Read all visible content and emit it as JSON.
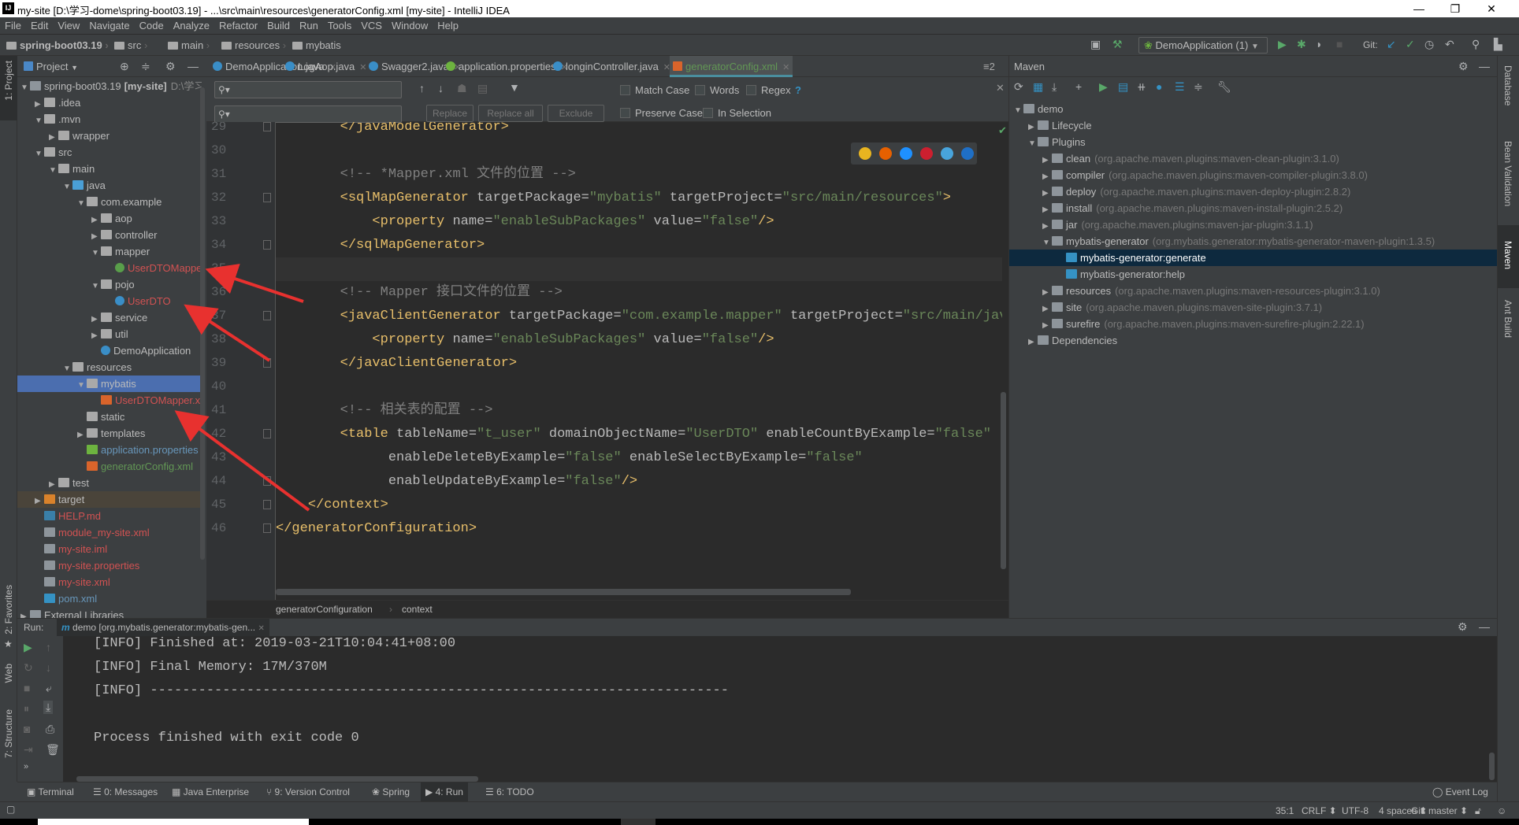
{
  "window": {
    "title": "my-site [D:\\学习-dome\\spring-boot03.19] - ...\\src\\main\\resources\\generatorConfig.xml [my-site] - IntelliJ IDEA",
    "app_icon": "IJ"
  },
  "menu": [
    "File",
    "Edit",
    "View",
    "Navigate",
    "Code",
    "Analyze",
    "Refactor",
    "Build",
    "Run",
    "Tools",
    "VCS",
    "Window",
    "Help"
  ],
  "breadcrumb": [
    "spring-boot03.19",
    "src",
    "main",
    "resources",
    "mybatis"
  ],
  "toolbar": {
    "run_config": "DemoApplication (1)",
    "git_label": "Git:"
  },
  "left_strip": {
    "project": "1: Project",
    "favorites": "2: Favorites",
    "web": "Web",
    "structure": "7: Structure"
  },
  "right_strip": {
    "database": "Database",
    "bean_validation": "Bean Validation",
    "maven": "Maven",
    "ant_build": "Ant Build"
  },
  "project_panel": {
    "title": "Project",
    "items": [
      {
        "depth": 0,
        "state": "open",
        "icon": "module",
        "label": "spring-boot03.19",
        "extra": "[my-site]",
        "path": "D:\\学习",
        "color": "#bbbbbb"
      },
      {
        "depth": 1,
        "state": "closed",
        "icon": "folder",
        "label": ".idea",
        "color": "#bbbbbb"
      },
      {
        "depth": 1,
        "state": "open",
        "icon": "folder",
        "label": ".mvn",
        "color": "#bbbbbb"
      },
      {
        "depth": 2,
        "state": "closed",
        "icon": "folder",
        "label": "wrapper",
        "color": "#bbbbbb"
      },
      {
        "depth": 1,
        "state": "open",
        "icon": "folder",
        "label": "src",
        "color": "#bbbbbb"
      },
      {
        "depth": 2,
        "state": "open",
        "icon": "folder",
        "label": "main",
        "color": "#bbbbbb"
      },
      {
        "depth": 3,
        "state": "open",
        "icon": "source-folder",
        "label": "java",
        "color": "#bbbbbb"
      },
      {
        "depth": 4,
        "state": "open",
        "icon": "package",
        "label": "com.example",
        "color": "#bbbbbb"
      },
      {
        "depth": 5,
        "state": "closed",
        "icon": "package",
        "label": "aop",
        "color": "#bbbbbb"
      },
      {
        "depth": 5,
        "state": "closed",
        "icon": "package",
        "label": "controller",
        "color": "#bbbbbb"
      },
      {
        "depth": 5,
        "state": "open",
        "icon": "package",
        "label": "mapper",
        "color": "#bbbbbb"
      },
      {
        "depth": 6,
        "state": "none",
        "icon": "interface",
        "label": "UserDTOMapper",
        "color": "#d25252"
      },
      {
        "depth": 5,
        "state": "open",
        "icon": "package",
        "label": "pojo",
        "color": "#bbbbbb"
      },
      {
        "depth": 6,
        "state": "none",
        "icon": "class",
        "label": "UserDTO",
        "color": "#d25252"
      },
      {
        "depth": 5,
        "state": "closed",
        "icon": "package",
        "label": "service",
        "color": "#bbbbbb"
      },
      {
        "depth": 5,
        "state": "closed",
        "icon": "package",
        "label": "util",
        "color": "#bbbbbb"
      },
      {
        "depth": 5,
        "state": "none",
        "icon": "spring-class",
        "label": "DemoApplication",
        "color": "#bbbbbb"
      },
      {
        "depth": 3,
        "state": "open",
        "icon": "resources-folder",
        "label": "resources",
        "color": "#bbbbbb"
      },
      {
        "depth": 4,
        "state": "open",
        "icon": "package",
        "label": "mybatis",
        "color": "#bbbbbb",
        "selected": true
      },
      {
        "depth": 5,
        "state": "none",
        "icon": "xml",
        "label": "UserDTOMapper.xml",
        "color": "#d25252"
      },
      {
        "depth": 4,
        "state": "none",
        "icon": "package",
        "label": "static",
        "color": "#bbbbbb"
      },
      {
        "depth": 4,
        "state": "closed",
        "icon": "package",
        "label": "templates",
        "color": "#bbbbbb"
      },
      {
        "depth": 4,
        "state": "none",
        "icon": "spring-properties",
        "label": "application.properties",
        "color": "#6897bb"
      },
      {
        "depth": 4,
        "state": "none",
        "icon": "xml",
        "label": "generatorConfig.xml",
        "color": "#629755"
      },
      {
        "depth": 2,
        "state": "closed",
        "icon": "folder",
        "label": "test",
        "color": "#bbbbbb"
      },
      {
        "depth": 1,
        "state": "closed",
        "icon": "excluded-folder",
        "label": "target",
        "color": "#bbbbbb",
        "excluded": true
      },
      {
        "depth": 1,
        "state": "none",
        "icon": "markdown",
        "label": "HELP.md",
        "color": "#d25252"
      },
      {
        "depth": 1,
        "state": "none",
        "icon": "xml-file",
        "label": "module_my-site.xml",
        "color": "#d25252"
      },
      {
        "depth": 1,
        "state": "none",
        "icon": "iml-file",
        "label": "my-site.iml",
        "color": "#d25252"
      },
      {
        "depth": 1,
        "state": "none",
        "icon": "properties-file",
        "label": "my-site.properties",
        "color": "#d25252"
      },
      {
        "depth": 1,
        "state": "none",
        "icon": "xml-file",
        "label": "my-site.xml",
        "color": "#d25252"
      },
      {
        "depth": 1,
        "state": "none",
        "icon": "maven",
        "label": "pom.xml",
        "color": "#6897bb"
      },
      {
        "depth": 0,
        "state": "closed",
        "icon": "libraries",
        "label": "External Libraries",
        "color": "#bbbbbb"
      }
    ]
  },
  "editor_tabs": [
    {
      "label": "DemoApplication.java",
      "icon": "spring-class",
      "active": false
    },
    {
      "label": "LogAop.java",
      "icon": "class",
      "active": false
    },
    {
      "label": "Swagger2.java",
      "icon": "class",
      "active": false
    },
    {
      "label": "application.properties",
      "icon": "spring-properties",
      "active": false
    },
    {
      "label": "longinController.java",
      "icon": "class",
      "active": false
    },
    {
      "label": "generatorConfig.xml",
      "icon": "xml",
      "active": true
    }
  ],
  "tabs_overflow": "≡2",
  "find_bar": {
    "search_value": "",
    "replace_value": "",
    "match_case": "Match Case",
    "words": "Words",
    "regex": "Regex",
    "help": "?",
    "preserve_case": "Preserve Case",
    "in_selection": "In Selection",
    "replace": "Replace",
    "replace_all": "Replace all",
    "exclude": "Exclude"
  },
  "code": {
    "current_line": 35,
    "lines": [
      {
        "n": 29,
        "tokens": [
          [
            "txt",
            "        "
          ],
          [
            "tag",
            "</javaModelGenerator>"
          ]
        ]
      },
      {
        "n": 30,
        "tokens": []
      },
      {
        "n": 31,
        "tokens": [
          [
            "txt",
            "        "
          ],
          [
            "cmt",
            "<!-- *Mapper.xml 文件的位置 -->"
          ]
        ]
      },
      {
        "n": 32,
        "tokens": [
          [
            "txt",
            "        "
          ],
          [
            "tag",
            "<sqlMapGenerator"
          ],
          [
            "attr",
            " targetPackage="
          ],
          [
            "val",
            "\"mybatis\""
          ],
          [
            "attr",
            " targetProject="
          ],
          [
            "val",
            "\"src/main/resources\""
          ],
          [
            "tag",
            ">"
          ]
        ]
      },
      {
        "n": 33,
        "tokens": [
          [
            "txt",
            "            "
          ],
          [
            "tag",
            "<property"
          ],
          [
            "attr",
            " name="
          ],
          [
            "val",
            "\"enableSubPackages\""
          ],
          [
            "attr",
            " value="
          ],
          [
            "val",
            "\"false\""
          ],
          [
            "tag",
            "/>"
          ]
        ]
      },
      {
        "n": 34,
        "tokens": [
          [
            "txt",
            "        "
          ],
          [
            "tag",
            "</sqlMapGenerator>"
          ]
        ]
      },
      {
        "n": 35,
        "tokens": []
      },
      {
        "n": 36,
        "tokens": [
          [
            "txt",
            "        "
          ],
          [
            "cmt",
            "<!-- Mapper 接口文件的位置 -->"
          ]
        ]
      },
      {
        "n": 37,
        "tokens": [
          [
            "txt",
            "        "
          ],
          [
            "tag",
            "<javaClientGenerator"
          ],
          [
            "attr",
            " targetPackage="
          ],
          [
            "val",
            "\"com.example.mapper\""
          ],
          [
            "attr",
            " targetProject="
          ],
          [
            "val",
            "\"src/main/java\""
          ]
        ]
      },
      {
        "n": 38,
        "tokens": [
          [
            "txt",
            "            "
          ],
          [
            "tag",
            "<property"
          ],
          [
            "attr",
            " name="
          ],
          [
            "val",
            "\"enableSubPackages\""
          ],
          [
            "attr",
            " value="
          ],
          [
            "val",
            "\"false\""
          ],
          [
            "tag",
            "/>"
          ]
        ]
      },
      {
        "n": 39,
        "tokens": [
          [
            "txt",
            "        "
          ],
          [
            "tag",
            "</javaClientGenerator>"
          ]
        ]
      },
      {
        "n": 40,
        "tokens": []
      },
      {
        "n": 41,
        "tokens": [
          [
            "txt",
            "        "
          ],
          [
            "cmt",
            "<!-- 相关表的配置 -->"
          ]
        ]
      },
      {
        "n": 42,
        "tokens": [
          [
            "txt",
            "        "
          ],
          [
            "tag",
            "<table"
          ],
          [
            "attr",
            " tableName="
          ],
          [
            "val",
            "\"t_user\""
          ],
          [
            "attr",
            " domainObjectName="
          ],
          [
            "val",
            "\"UserDTO\""
          ],
          [
            "attr",
            " enableCountByExample="
          ],
          [
            "val",
            "\"false\""
          ]
        ]
      },
      {
        "n": 43,
        "tokens": [
          [
            "txt",
            "              "
          ],
          [
            "attr",
            "enableDeleteByExample="
          ],
          [
            "val",
            "\"false\""
          ],
          [
            "attr",
            " enableSelectByExample="
          ],
          [
            "val",
            "\"false\""
          ]
        ]
      },
      {
        "n": 44,
        "tokens": [
          [
            "txt",
            "              "
          ],
          [
            "attr",
            "enableUpdateByExample="
          ],
          [
            "val",
            "\"false\""
          ],
          [
            "tag",
            "/>"
          ]
        ]
      },
      {
        "n": 45,
        "tokens": [
          [
            "txt",
            "    "
          ],
          [
            "tag",
            "</context>"
          ]
        ]
      },
      {
        "n": 46,
        "tokens": [
          [
            "tag",
            "</generatorConfiguration>"
          ]
        ]
      }
    ]
  },
  "editor_breadcrumb": [
    "generatorConfiguration",
    "context"
  ],
  "browser_icons": [
    "chrome-icon",
    "firefox-icon",
    "safari-icon",
    "opera-icon",
    "ie-icon",
    "edge-icon"
  ],
  "maven": {
    "title": "Maven",
    "items": [
      {
        "depth": 0,
        "state": "open",
        "icon": "maven-project",
        "label": "demo",
        "detail": ""
      },
      {
        "depth": 1,
        "state": "closed",
        "icon": "lifecycle",
        "label": "Lifecycle",
        "detail": ""
      },
      {
        "depth": 1,
        "state": "open",
        "icon": "plugins",
        "label": "Plugins",
        "detail": ""
      },
      {
        "depth": 2,
        "state": "closed",
        "icon": "plugin",
        "label": "clean",
        "detail": "(org.apache.maven.plugins:maven-clean-plugin:3.1.0)"
      },
      {
        "depth": 2,
        "state": "closed",
        "icon": "plugin",
        "label": "compiler",
        "detail": "(org.apache.maven.plugins:maven-compiler-plugin:3.8.0)"
      },
      {
        "depth": 2,
        "state": "closed",
        "icon": "plugin",
        "label": "deploy",
        "detail": "(org.apache.maven.plugins:maven-deploy-plugin:2.8.2)"
      },
      {
        "depth": 2,
        "state": "closed",
        "icon": "plugin",
        "label": "install",
        "detail": "(org.apache.maven.plugins:maven-install-plugin:2.5.2)"
      },
      {
        "depth": 2,
        "state": "closed",
        "icon": "plugin",
        "label": "jar",
        "detail": "(org.apache.maven.plugins:maven-jar-plugin:3.1.1)"
      },
      {
        "depth": 2,
        "state": "open",
        "icon": "plugin",
        "label": "mybatis-generator",
        "detail": "(org.mybatis.generator:mybatis-generator-maven-plugin:1.3.5)"
      },
      {
        "depth": 3,
        "state": "none",
        "icon": "goal",
        "label": "mybatis-generator:generate",
        "detail": "",
        "selected": true
      },
      {
        "depth": 3,
        "state": "none",
        "icon": "goal",
        "label": "mybatis-generator:help",
        "detail": ""
      },
      {
        "depth": 2,
        "state": "closed",
        "icon": "plugin",
        "label": "resources",
        "detail": "(org.apache.maven.plugins:maven-resources-plugin:3.1.0)"
      },
      {
        "depth": 2,
        "state": "closed",
        "icon": "plugin",
        "label": "site",
        "detail": "(org.apache.maven.plugins:maven-site-plugin:3.7.1)"
      },
      {
        "depth": 2,
        "state": "closed",
        "icon": "plugin",
        "label": "surefire",
        "detail": "(org.apache.maven.plugins:maven-surefire-plugin:2.22.1)"
      },
      {
        "depth": 1,
        "state": "closed",
        "icon": "dependencies",
        "label": "Dependencies",
        "detail": ""
      }
    ]
  },
  "run_panel": {
    "label": "Run:",
    "tab": "demo [org.mybatis.generator:mybatis-gen...",
    "console": [
      "[INFO] Finished at: 2019-03-21T10:04:41+08:00",
      "[INFO] Final Memory: 17M/370M",
      "[INFO] ------------------------------------------------------------------------",
      "",
      "Process finished with exit code 0"
    ]
  },
  "bottom_tabs": [
    {
      "label": "Terminal",
      "icon": "terminal-icon"
    },
    {
      "label": "0: Messages",
      "icon": "messages-icon"
    },
    {
      "label": "Java Enterprise",
      "icon": "java-enterprise-icon"
    },
    {
      "label": "9: Version Control",
      "icon": "version-control-icon"
    },
    {
      "label": "Spring",
      "icon": "spring-icon"
    },
    {
      "label": "4: Run",
      "icon": "run-icon",
      "active": true
    },
    {
      "label": "6: TODO",
      "icon": "todo-icon"
    }
  ],
  "event_log": "Event Log",
  "status": {
    "position": "35:1",
    "line_sep": "CRLF ⬍",
    "encoding": "UTF-8",
    "indent": "4 spaces ⬍",
    "git": "Git: master ⬍"
  },
  "colors": {
    "selection": "#4b6eaf",
    "maven_selection": "#0d293e",
    "editor_bg": "#2b2b2b",
    "panel_bg": "#3c3f41",
    "annotation_arrow": "#e8312f"
  }
}
